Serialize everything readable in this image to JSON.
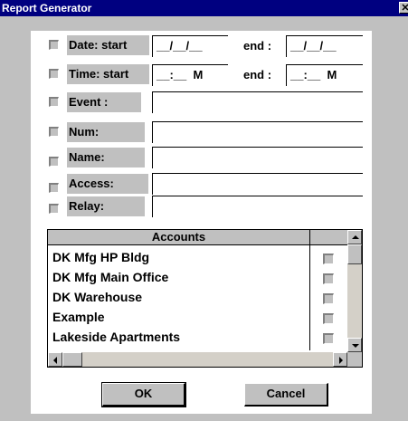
{
  "window": {
    "title": "Report Generator",
    "close_glyph": "✕"
  },
  "filters": [
    {
      "key": "date",
      "label": "Date: start",
      "start": "__/__/__",
      "end_label": "end :",
      "end": "__/__/__"
    },
    {
      "key": "time",
      "label": "Time: start",
      "start": "__:__  M",
      "end_label": "end :",
      "end": "__:__  M"
    },
    {
      "key": "event",
      "label": "Event :",
      "value": ""
    },
    {
      "key": "num",
      "label": "Num:",
      "value": ""
    },
    {
      "key": "name",
      "label": "Name:",
      "value": ""
    },
    {
      "key": "access",
      "label": "Access:",
      "value": ""
    },
    {
      "key": "relay",
      "label": "Relay:",
      "value": ""
    }
  ],
  "accounts": {
    "header": "Accounts",
    "rows": [
      {
        "name": "DK Mfg HP Bldg",
        "checked": false
      },
      {
        "name": "DK Mfg Main Office",
        "checked": false
      },
      {
        "name": "DK Warehouse",
        "checked": false
      },
      {
        "name": "Example",
        "checked": false
      },
      {
        "name": "Lakeside Apartments",
        "checked": false
      }
    ]
  },
  "buttons": {
    "ok": "OK",
    "cancel": "Cancel"
  },
  "colors": {
    "titlebar": "#000080",
    "face": "#c0c0c0",
    "panel": "#ffffff"
  }
}
